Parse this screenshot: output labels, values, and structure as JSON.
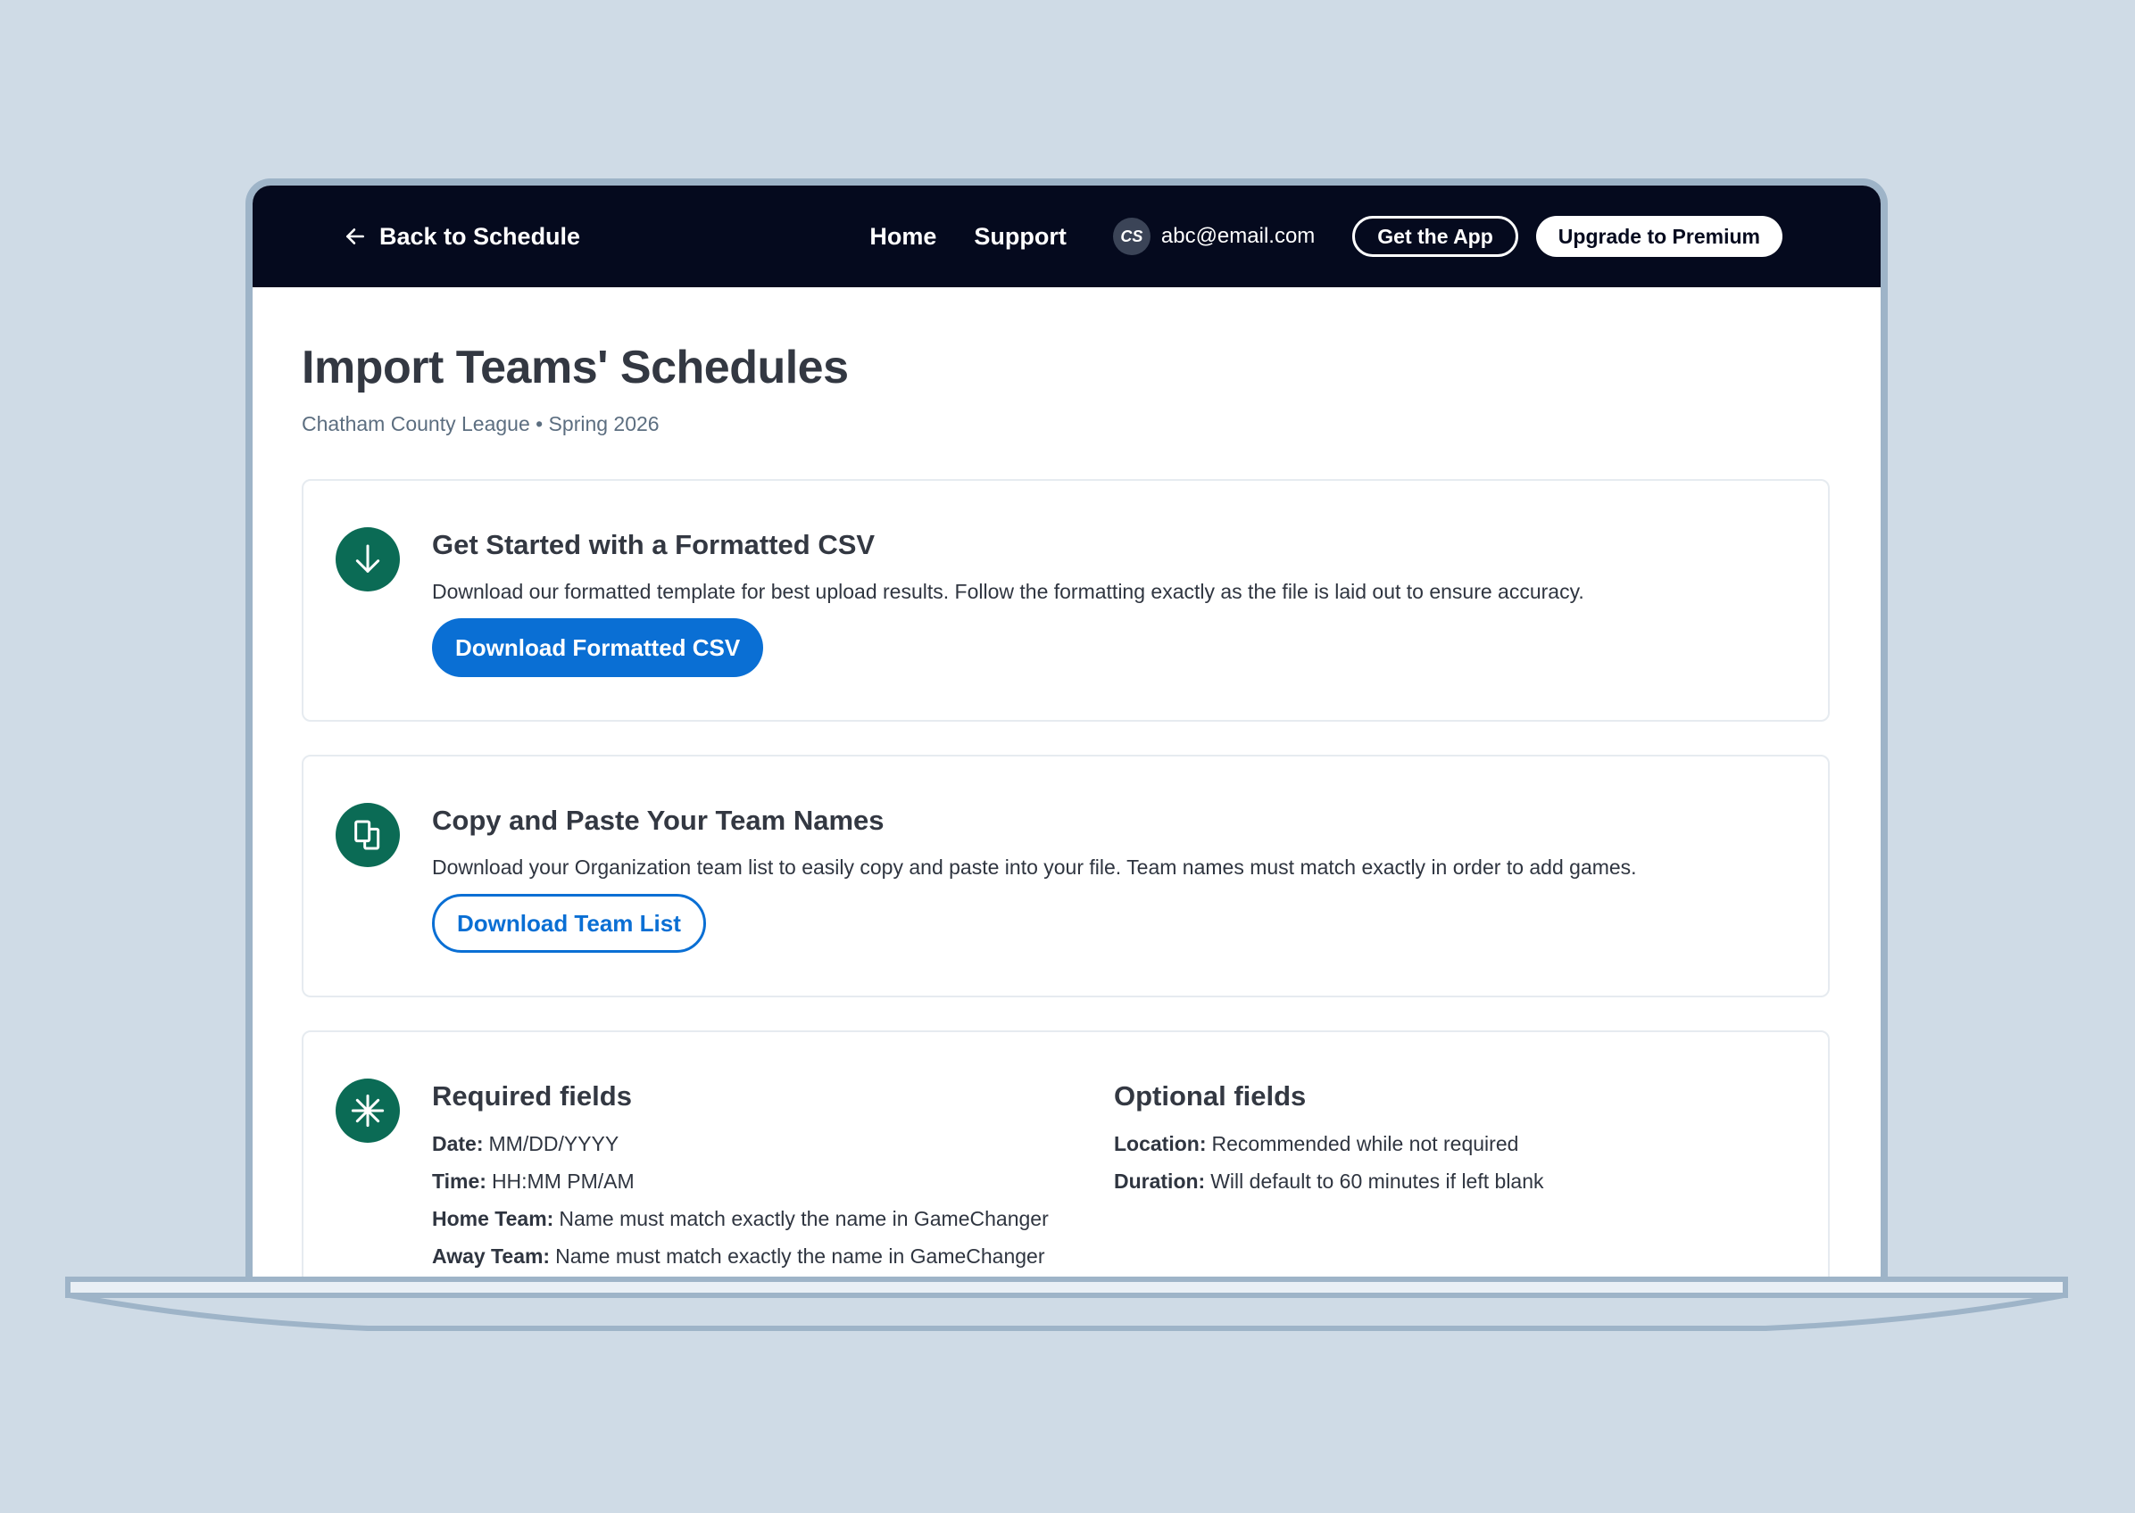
{
  "nav": {
    "back_label": "Back to Schedule",
    "home": "Home",
    "support": "Support",
    "avatar_initials": "CS",
    "email": "abc@email.com",
    "get_app": "Get the App",
    "upgrade": "Upgrade to Premium"
  },
  "page": {
    "title": "Import Teams' Schedules",
    "subtitle": "Chatham County League • Spring 2026"
  },
  "cards": {
    "csv": {
      "icon": "arrow-down-icon",
      "title": "Get Started with a Formatted CSV",
      "description": "Download our formatted template for best upload results. Follow the formatting exactly as the file is laid out to ensure accuracy.",
      "button": "Download Formatted CSV"
    },
    "teams": {
      "icon": "copy-icon",
      "title": "Copy and Paste Your Team Names",
      "description": "Download your Organization team list to easily copy and paste into your file. Team names must match exactly in order to add games.",
      "button": "Download Team List"
    },
    "fields": {
      "icon": "asterisk-icon",
      "required_title": "Required fields",
      "required": [
        {
          "key": "Date:",
          "value": "MM/DD/YYYY"
        },
        {
          "key": "Time:",
          "value": "HH:MM PM/AM"
        },
        {
          "key": "Home Team:",
          "value": "Name must match exactly the name in GameChanger"
        },
        {
          "key": "Away Team:",
          "value": "Name must match exactly the name in GameChanger"
        }
      ],
      "optional_title": "Optional fields",
      "optional": [
        {
          "key": "Location:",
          "value": "Recommended while not required"
        },
        {
          "key": "Duration:",
          "value": "Will default to 60 minutes if left blank"
        }
      ]
    }
  },
  "colors": {
    "background": "#cfdbe6",
    "navbar": "#050a1e",
    "accent_blue": "#0a6fd4",
    "icon_green": "#0b6b55",
    "frame": "#9eb4c8"
  }
}
